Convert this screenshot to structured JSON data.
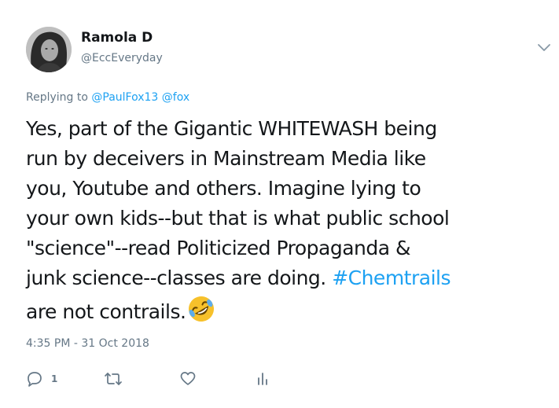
{
  "tweet": {
    "author_name": "Ramola D",
    "author_handle": "@EccEveryday",
    "replying_prefix": "Replying to",
    "mentions": [
      "@PaulFox13",
      "@fox"
    ],
    "body_lines": [
      "Yes, part of the Gigantic WHITEWASH being",
      "run by deceivers in Mainstream Media like",
      "you, Youtube and others. Imagine lying to",
      "your own kids--but that is what public school",
      "\"science\"--read Politicized Propaganda &",
      "junk science--classes are doing."
    ],
    "hashtag": "#Chemtrails",
    "last_line": "are not contrails.",
    "emoji": "rolling-on-the-floor-laughing",
    "timestamp": "4:35 PM - 31 Oct 2018",
    "reply_count": "1"
  },
  "icons": {
    "menu": "chevron-down-icon",
    "reply": "reply-icon",
    "retweet": "retweet-icon",
    "like": "heart-icon",
    "analytics": "analytics-icon"
  },
  "colors": {
    "link": "#1da1f2",
    "secondary_text": "#657786",
    "primary_text": "#14171a",
    "emoji_face": "#f7c12b"
  }
}
